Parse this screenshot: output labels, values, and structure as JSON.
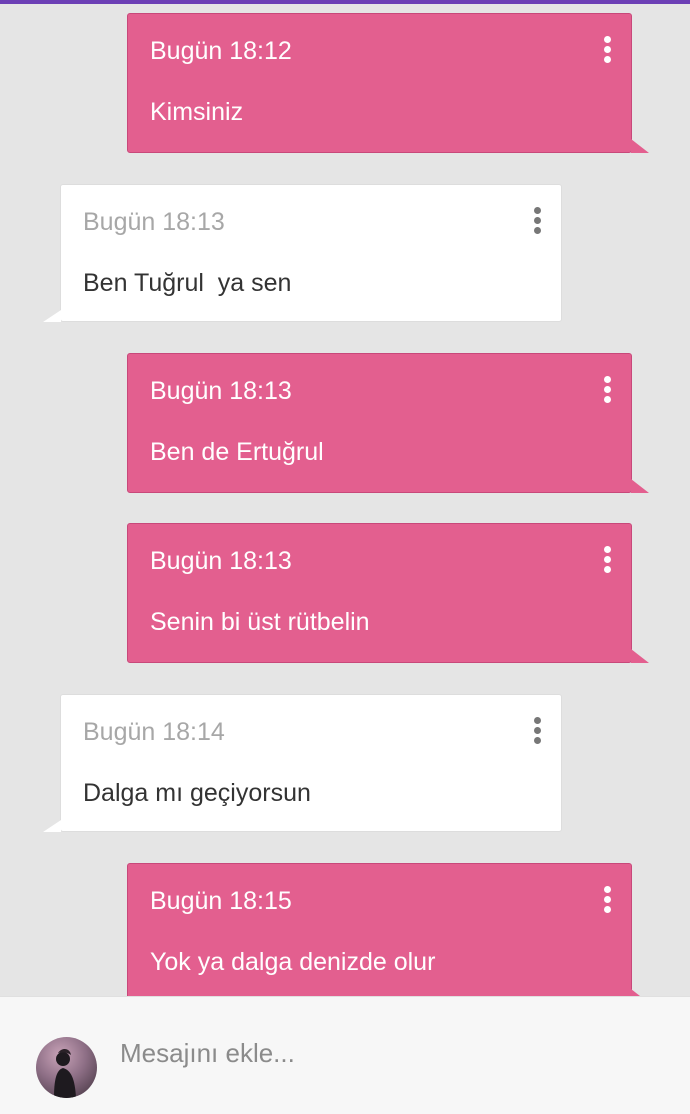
{
  "messages": [
    {
      "side": "sent",
      "time": "Bugün 18:12",
      "text": "Kimsiniz"
    },
    {
      "side": "received",
      "time": "Bugün 18:13",
      "text": "Ben Tuğrul  ya sen"
    },
    {
      "side": "sent",
      "time": "Bugün 18:13",
      "text": "Ben de Ertuğrul"
    },
    {
      "side": "sent",
      "time": "Bugün 18:13",
      "text": "Senin bi üst rütbelin"
    },
    {
      "side": "received",
      "time": "Bugün 18:14",
      "text": "Dalga mı geçiyorsun"
    },
    {
      "side": "sent",
      "time": "Bugün 18:15",
      "text": "Yok ya dalga denizde olur"
    }
  ],
  "composer": {
    "placeholder": "Mesajını ekle..."
  },
  "icons": {
    "message_menu": "more-vertical-icon"
  },
  "colors": {
    "sent_bubble": "#e35f8f",
    "received_bubble": "#ffffff",
    "accent_bar": "#6c3fb5"
  }
}
